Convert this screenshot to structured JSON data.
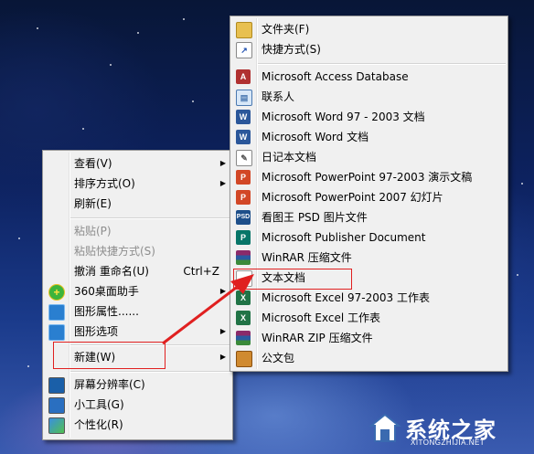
{
  "context_menu": {
    "items": [
      {
        "label": "查看(V)",
        "submenu": true
      },
      {
        "label": "排序方式(O)",
        "submenu": true
      },
      {
        "label": "刷新(E)"
      },
      {
        "label": "粘贴(P)",
        "disabled": true
      },
      {
        "label": "粘贴快捷方式(S)",
        "disabled": true
      },
      {
        "label": "撤消 重命名(U)",
        "shortcut": "Ctrl+Z"
      },
      {
        "label": "360桌面助手",
        "icon": "360-desktop-icon",
        "submenu": true
      },
      {
        "label": "图形属性......",
        "icon": "graphics-properties-icon"
      },
      {
        "label": "图形选项",
        "icon": "graphics-options-icon",
        "submenu": true
      },
      {
        "label": "新建(W)",
        "submenu": true,
        "highlighted": true
      },
      {
        "label": "屏幕分辨率(C)",
        "icon": "screen-resolution-icon"
      },
      {
        "label": "小工具(G)",
        "icon": "gadgets-icon"
      },
      {
        "label": "个性化(R)",
        "icon": "personalize-icon"
      }
    ]
  },
  "new_submenu": {
    "items": [
      {
        "label": "文件夹(F)",
        "icon": "folder-icon"
      },
      {
        "label": "快捷方式(S)",
        "icon": "shortcut-icon"
      },
      {
        "label": "Microsoft Access Database",
        "icon": "access-icon"
      },
      {
        "label": "联系人",
        "icon": "contact-icon"
      },
      {
        "label": "Microsoft Word 97 - 2003 文档",
        "icon": "word-97-icon"
      },
      {
        "label": "Microsoft Word 文档",
        "icon": "word-icon"
      },
      {
        "label": "日记本文档",
        "icon": "journal-icon"
      },
      {
        "label": "Microsoft PowerPoint 97-2003 演示文稿",
        "icon": "powerpoint-97-icon"
      },
      {
        "label": "Microsoft PowerPoint 2007 幻灯片",
        "icon": "powerpoint-icon"
      },
      {
        "label": "看图王 PSD 图片文件",
        "icon": "psd-icon"
      },
      {
        "label": "Microsoft Publisher Document",
        "icon": "publisher-icon"
      },
      {
        "label": "WinRAR 压缩文件",
        "icon": "winrar-icon"
      },
      {
        "label": "文本文档",
        "icon": "text-document-icon",
        "highlighted": true
      },
      {
        "label": "Microsoft Excel 97-2003 工作表",
        "icon": "excel-97-icon"
      },
      {
        "label": "Microsoft Excel 工作表",
        "icon": "excel-icon"
      },
      {
        "label": "WinRAR ZIP 压缩文件",
        "icon": "winrar-zip-icon"
      },
      {
        "label": "公文包",
        "icon": "briefcase-icon"
      }
    ]
  },
  "watermark": {
    "title": "系统之家",
    "url": "XITONGZHIJIA.NET"
  },
  "colors": {
    "annotation": "#e02020",
    "menu_bg": "#f0f0f0"
  }
}
